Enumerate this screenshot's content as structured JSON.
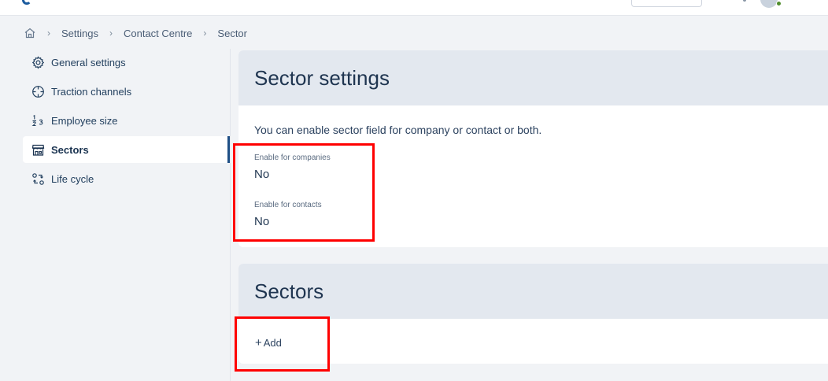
{
  "breadcrumb": {
    "items": [
      "Settings",
      "Contact Centre",
      "Sector"
    ]
  },
  "sidebar": {
    "items": [
      {
        "label": "General settings",
        "icon": "gear-icon"
      },
      {
        "label": "Traction channels",
        "icon": "crosshair-icon"
      },
      {
        "label": "Employee size",
        "icon": "fraction-icon"
      },
      {
        "label": "Sectors",
        "icon": "storefront-icon",
        "active": true
      },
      {
        "label": "Life cycle",
        "icon": "cycle-icon"
      }
    ]
  },
  "sector_settings": {
    "title": "Sector settings",
    "description": "You can enable sector field for company or contact or both.",
    "companies_label": "Enable for companies",
    "companies_value": "No",
    "contacts_label": "Enable for contacts",
    "contacts_value": "No"
  },
  "sectors": {
    "title": "Sectors",
    "add_label": "Add"
  },
  "colors": {
    "accent": "#1f4f86",
    "highlight": "#ff0000",
    "status_online": "#4f8d2c"
  }
}
